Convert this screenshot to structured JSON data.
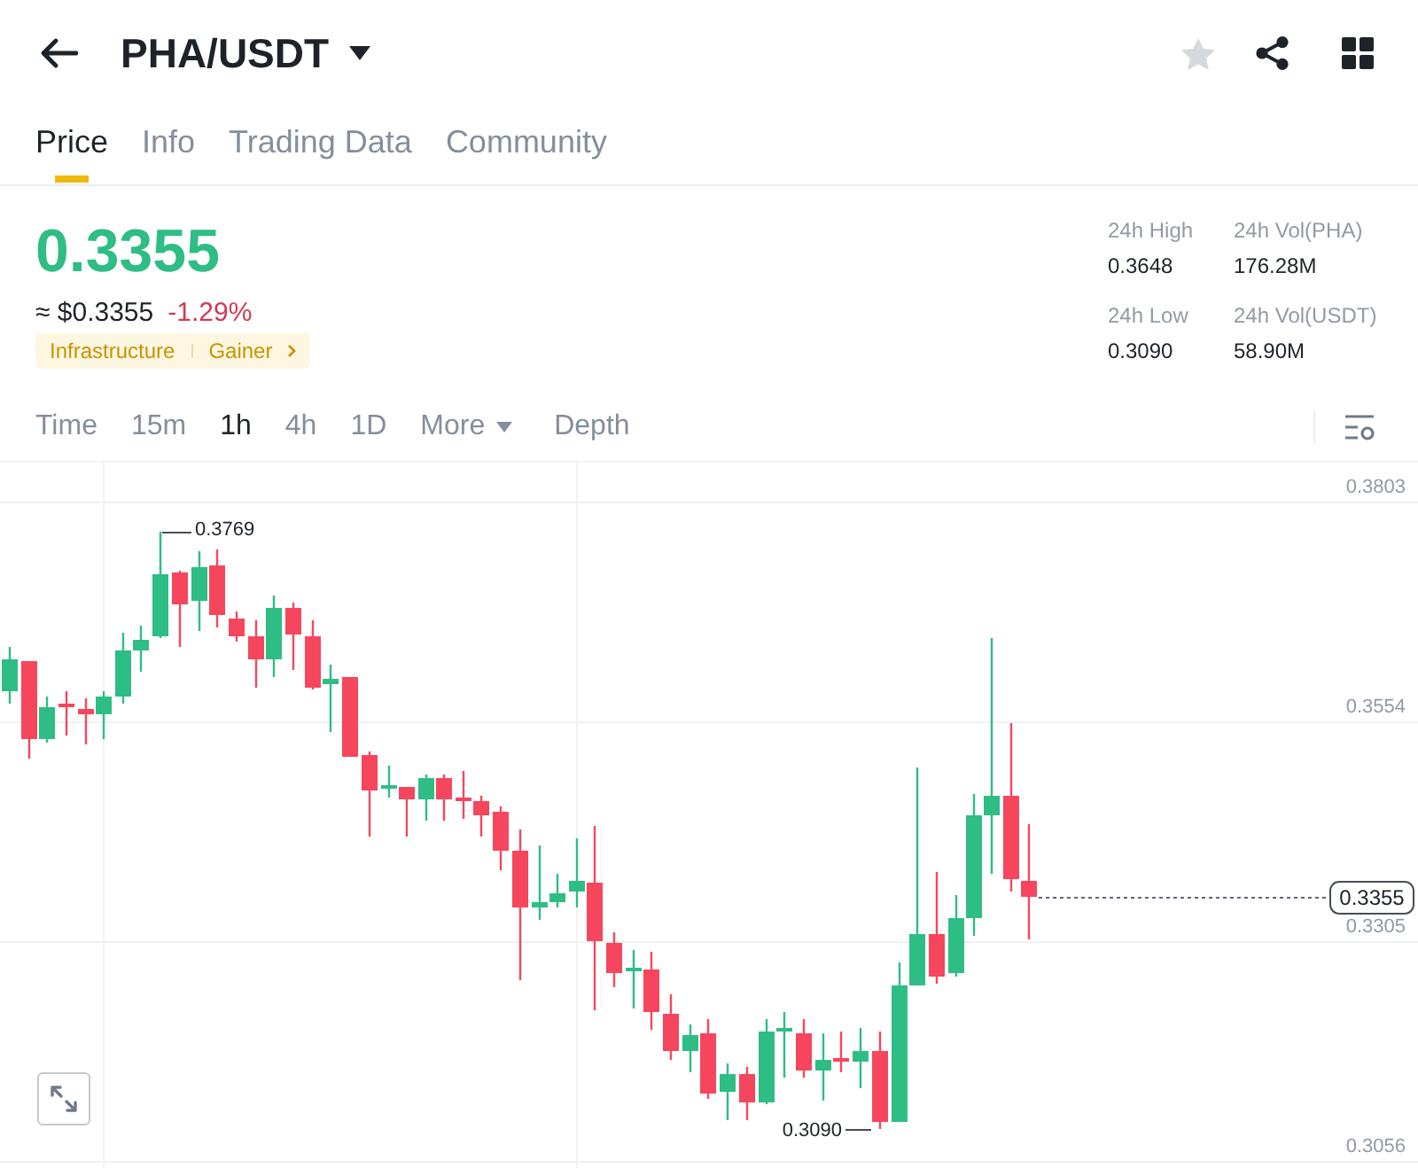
{
  "header": {
    "pair": "PHA/USDT"
  },
  "tabs": [
    {
      "label": "Price",
      "selected": true
    },
    {
      "label": "Info",
      "selected": false
    },
    {
      "label": "Trading Data",
      "selected": false
    },
    {
      "label": "Community",
      "selected": false
    }
  ],
  "ticker": {
    "last_price": "0.3355",
    "last_price_up": true,
    "usd_price": "≈ $0.3355",
    "change": "-1.29%",
    "change_up": false,
    "tags": [
      "Infrastructure",
      "Gainer"
    ]
  },
  "stats": [
    {
      "label": "24h High",
      "value": "0.3648"
    },
    {
      "label": "24h Vol(PHA)",
      "value": "176.28M"
    },
    {
      "label": "24h Low",
      "value": "0.3090"
    },
    {
      "label": "24h Vol(USDT)",
      "value": "58.90M"
    }
  ],
  "intervals": [
    {
      "label": "Time",
      "kind": "option",
      "selected": false
    },
    {
      "label": "15m",
      "kind": "option",
      "selected": false
    },
    {
      "label": "1h",
      "kind": "option",
      "selected": true
    },
    {
      "label": "4h",
      "kind": "option",
      "selected": false
    },
    {
      "label": "1D",
      "kind": "option",
      "selected": false
    },
    {
      "label": "More",
      "kind": "dropdown",
      "selected": false
    },
    {
      "label": "Depth",
      "kind": "option",
      "selected": false
    }
  ],
  "chart": {
    "price_axis": [
      "0.3803",
      "0.3554",
      "0.3305",
      "0.3056"
    ],
    "high_marker": "0.3769",
    "low_marker": "0.3090",
    "last_price_tag": "0.3355"
  }
}
